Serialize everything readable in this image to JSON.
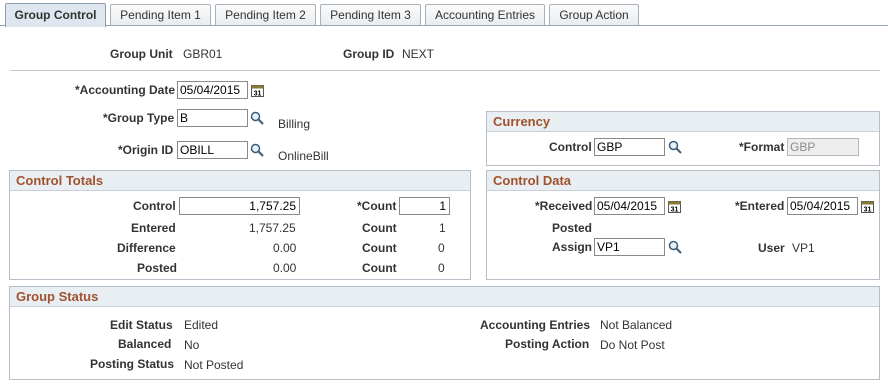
{
  "tabs": [
    {
      "label": "Group Control",
      "active": true
    },
    {
      "label": "Pending Item 1",
      "active": false
    },
    {
      "label": "Pending Item 2",
      "active": false
    },
    {
      "label": "Pending Item 3",
      "active": false
    },
    {
      "label": "Accounting Entries",
      "active": false
    },
    {
      "label": "Group Action",
      "active": false
    }
  ],
  "header": {
    "group_unit_label": "Group Unit",
    "group_unit_value": "GBR01",
    "group_id_label": "Group ID",
    "group_id_value": "NEXT"
  },
  "form": {
    "accounting_date_label": "*Accounting Date",
    "accounting_date_value": "05/04/2015",
    "group_type_label": "*Group Type",
    "group_type_value": "B",
    "group_type_desc": "Billing",
    "origin_id_label": "*Origin ID",
    "origin_id_value": "OBILL",
    "origin_id_desc": "OnlineBill"
  },
  "currency": {
    "title": "Currency",
    "control_label": "Control",
    "control_value": "GBP",
    "format_label": "*Format",
    "format_value": "GBP"
  },
  "control_totals": {
    "title": "Control Totals",
    "control_label": "Control",
    "control_value": "1,757.25",
    "count_req_label": "*Count",
    "count_value": "1",
    "entered_label": "Entered",
    "entered_value": "1,757.25",
    "entered_count_label": "Count",
    "entered_count_value": "1",
    "difference_label": "Difference",
    "difference_value": "0.00",
    "difference_count_label": "Count",
    "difference_count_value": "0",
    "posted_label": "Posted",
    "posted_value": "0.00",
    "posted_count_label": "Count",
    "posted_count_value": "0"
  },
  "control_data": {
    "title": "Control Data",
    "received_label": "*Received",
    "received_value": "05/04/2015",
    "entered_label": "*Entered",
    "entered_value": "05/04/2015",
    "posted_label": "Posted",
    "assign_label": "Assign",
    "assign_value": "VP1",
    "user_label": "User",
    "user_value": "VP1"
  },
  "group_status": {
    "title": "Group Status",
    "edit_status_label": "Edit Status",
    "edit_status_value": "Edited",
    "balanced_label": "Balanced",
    "balanced_value": "No",
    "posting_status_label": "Posting Status",
    "posting_status_value": "Not Posted",
    "accounting_entries_label": "Accounting Entries",
    "accounting_entries_value": "Not Balanced",
    "posting_action_label": "Posting Action",
    "posting_action_value": "Do Not Post"
  },
  "colors": {
    "group_header_text": "#a0522d",
    "group_header_bg": "#e9eef3",
    "active_tab_bg": "#dfe6ef"
  },
  "icons": [
    "calendar-icon",
    "lookup-magnifier-icon"
  ]
}
